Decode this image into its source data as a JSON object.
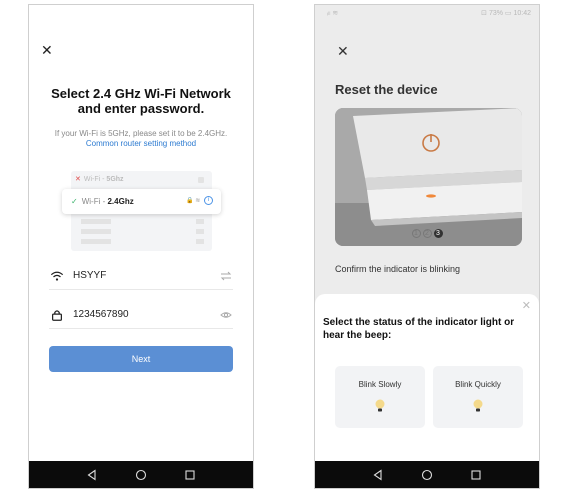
{
  "left_screen": {
    "title": "Select 2.4 GHz Wi-Fi Network and enter password.",
    "hint": "If your Wi-Fi is 5GHz, please set it to be 2.4GHz.",
    "help_link": "Common router setting method",
    "illustration": {
      "bad_network_prefix": "Wi-Fi - ",
      "bad_network_band": "5Ghz",
      "good_network_prefix": "Wi-Fi - ",
      "good_network_band": "2.4Ghz",
      "info_glyph": "i"
    },
    "wifi_name": "HSYYF",
    "password": "1234567890",
    "next_label": "Next",
    "icons": {
      "close": "close-icon",
      "wifi": "wifi-icon",
      "switch": "switch-network-icon",
      "lock": "lock-icon",
      "eye": "eye-icon"
    },
    "colors": {
      "primary_button": "#5b8fd4",
      "link": "#2d7bd1",
      "success": "#3bb36b",
      "error": "#e04848"
    }
  },
  "right_screen": {
    "status_left": "ᵢₗₗ ≋",
    "status_right": "⊡ 73% ▭ 10:42",
    "title": "Reset the device",
    "carousel_pages": [
      "1",
      "2",
      "3"
    ],
    "carousel_active": 3,
    "caption": "Confirm the indicator is blinking",
    "sheet": {
      "title": "Select the status of the indicator light or hear the beep:",
      "options": [
        {
          "label": "Blink Slowly"
        },
        {
          "label": "Blink Quickly"
        }
      ]
    },
    "colors": {
      "indicator": "#f0883a",
      "bulb": "#f4d98b"
    }
  },
  "navbar": {
    "icons": [
      "back-icon",
      "home-icon",
      "recents-icon"
    ]
  }
}
